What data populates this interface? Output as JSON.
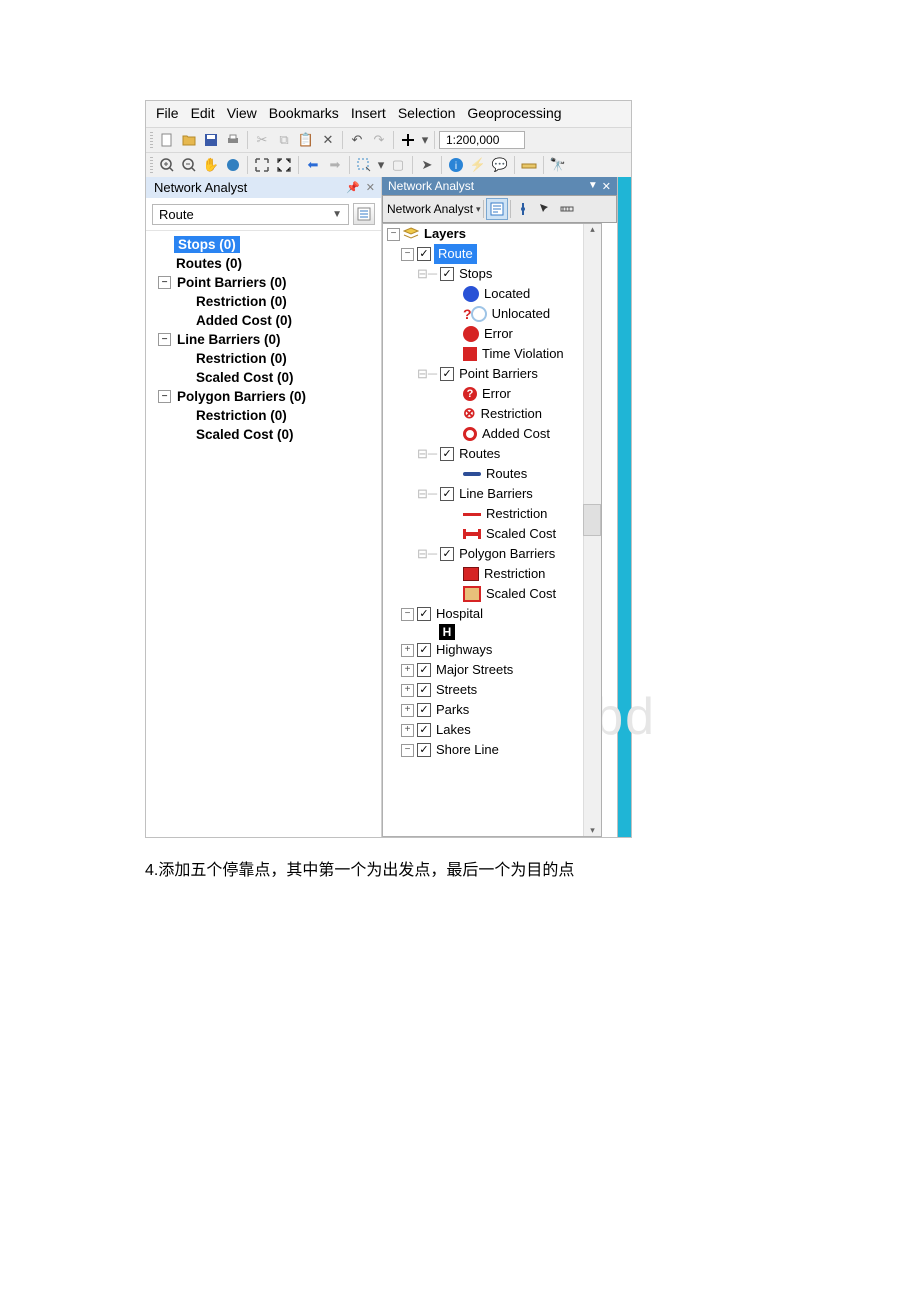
{
  "menu": {
    "file": "File",
    "edit": "Edit",
    "view": "View",
    "bookmarks": "Bookmarks",
    "insert": "Insert",
    "selection": "Selection",
    "geoprocessing": "Geoprocessing"
  },
  "scale": "1:200,000",
  "na_panel": {
    "title": "Network Analyst",
    "combo": "Route",
    "items": [
      {
        "label": "Stops (0)",
        "selected": true
      },
      {
        "label": "Routes (0)"
      },
      {
        "label": "Point Barriers (0)",
        "expandable": true,
        "children": [
          "Restriction (0)",
          "Added Cost (0)"
        ]
      },
      {
        "label": "Line Barriers (0)",
        "expandable": true,
        "children": [
          "Restriction (0)",
          "Scaled Cost (0)"
        ]
      },
      {
        "label": "Polygon Barriers (0)",
        "expandable": true,
        "children": [
          "Restriction (0)",
          "Scaled Cost (0)"
        ]
      }
    ]
  },
  "na_floatbar": {
    "title": "Network Analyst",
    "dropdown": "Network Analyst"
  },
  "toc": {
    "root": "Layers",
    "route": "Route",
    "stops": "Stops",
    "located": "Located",
    "unlocated": "Unlocated",
    "error": "Error",
    "time_violation": "Time Violation",
    "point_barriers": "Point Barriers",
    "pb_error": "Error",
    "pb_restriction": "Restriction",
    "pb_added": "Added Cost",
    "routes": "Routes",
    "routes_sym": "Routes",
    "line_barriers": "Line Barriers",
    "lb_restriction": "Restriction",
    "lb_scaled": "Scaled Cost",
    "polygon_barriers": "Polygon Barriers",
    "gb_restriction": "Restriction",
    "gb_scaled": "Scaled Cost",
    "hospital": "Hospital",
    "hospital_sym": "H",
    "highways": "Highways",
    "major_streets": "Major Streets",
    "streets": "Streets",
    "parks": "Parks",
    "lakes": "Lakes",
    "shore": "Shore Line"
  },
  "caption": "4.添加五个停靠点，其中第一个为出发点，最后一个为目的点",
  "watermark": "www.bd"
}
